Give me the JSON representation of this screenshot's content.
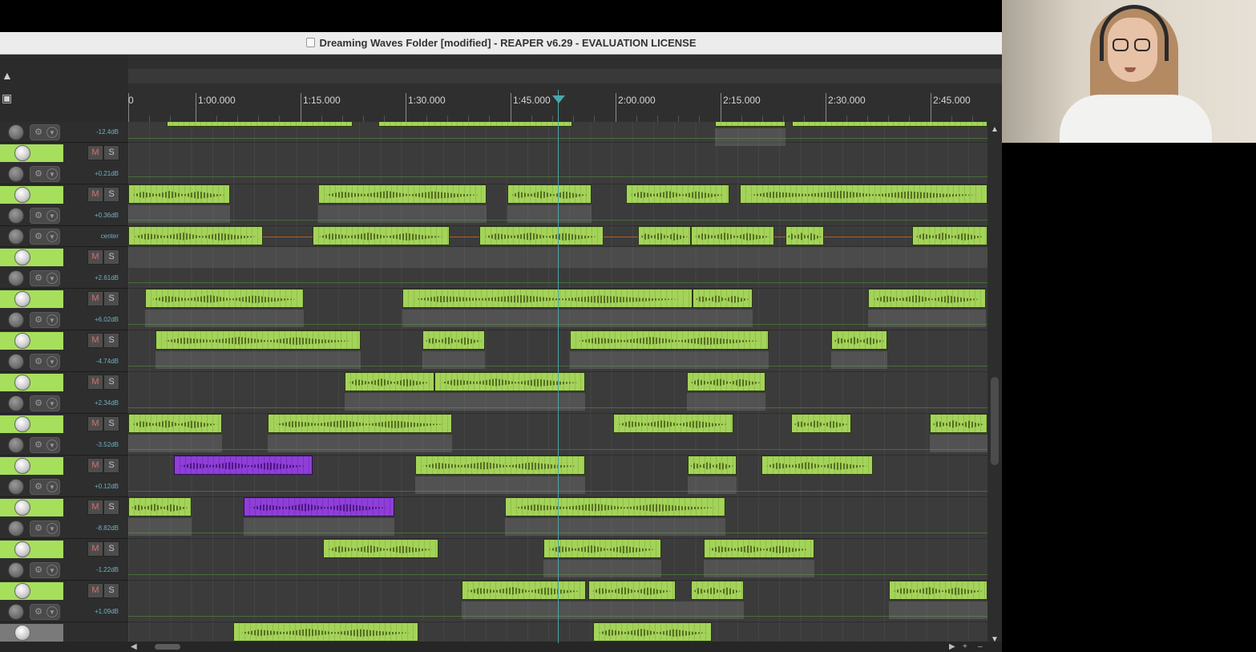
{
  "window": {
    "title": "Dreaming Waves Folder [modified] - REAPER v6.29 - EVALUATION LICENSE"
  },
  "ruler": {
    "labels": [
      "0",
      "1:00.000",
      "1:15.000",
      "1:30.000",
      "1:45.000",
      "2:00.000",
      "2:15.000",
      "2:30.000",
      "2:45.000"
    ]
  },
  "playhead": {
    "position": "1:52.000"
  },
  "tracks": [
    {
      "volume": "-12.4dB",
      "color": "#a6df5c"
    },
    {
      "volume": "+0.21dB",
      "color": "#a6df5c",
      "mute": "M",
      "solo": "S"
    },
    {
      "volume": "+0.36dB",
      "color": "#a6df5c",
      "mute": "M",
      "solo": "S"
    },
    {
      "volume": "center"
    },
    {
      "volume": "+2.61dB",
      "color": "#a6df5c",
      "mute": "M",
      "solo": "S"
    },
    {
      "volume": "+6.02dB",
      "color": "#a6df5c",
      "mute": "M",
      "solo": "S"
    },
    {
      "volume": "-4.74dB",
      "color": "#a6df5c",
      "mute": "M",
      "solo": "S"
    },
    {
      "volume": "+2.34dB",
      "color": "#a6df5c",
      "mute": "M",
      "solo": "S"
    },
    {
      "volume": "-3.52dB",
      "color": "#a6df5c",
      "mute": "M",
      "solo": "S"
    },
    {
      "volume": "+0.12dB",
      "color": "#a6df5c",
      "mute": "M",
      "solo": "S"
    },
    {
      "volume": "-8.82dB",
      "color": "#a6df5c",
      "mute": "M",
      "solo": "S"
    },
    {
      "volume": "-1.22dB",
      "color": "#a6df5c",
      "mute": "M",
      "solo": "S"
    },
    {
      "volume": "+1.09dB",
      "color": "#a6df5c",
      "mute": "M",
      "solo": "S"
    }
  ],
  "colors": {
    "item": "#a4d35a",
    "item_alt": "#8e3fd8",
    "playhead": "#4aa6a8",
    "track": "#a6df5c"
  },
  "icons": {
    "top": [
      "metronome-icon",
      "lock-icon"
    ],
    "scroll": [
      "arrow-up-icon",
      "arrow-down-icon",
      "zoom-in-icon",
      "zoom-out-icon"
    ]
  }
}
